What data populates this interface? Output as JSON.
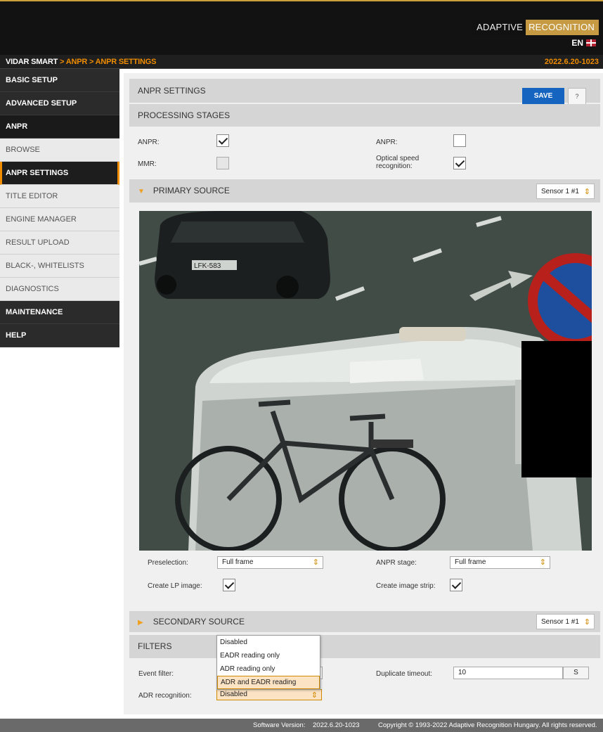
{
  "brand": {
    "word1": "ADAPTIVE",
    "word2": "RECOGNITION"
  },
  "language": "EN",
  "breadcrumb": {
    "root": "VIDAR SMART",
    "sep1": " > ",
    "section": "ANPR",
    "sep2": " > ",
    "page": "ANPR SETTINGS"
  },
  "version_top": "2022.6.20-1023",
  "sidebar": {
    "basic_setup": "BASIC SETUP",
    "advanced_setup": "ADVANCED SETUP",
    "anpr": "ANPR",
    "browse": "BROWSE",
    "anpr_settings": "ANPR SETTINGS",
    "title_editor": "TITLE EDITOR",
    "engine_manager": "ENGINE MANAGER",
    "result_upload": "RESULT UPLOAD",
    "black_whitelists": "BLACK-, WHITELISTS",
    "diagnostics": "DIAGNOSTICS",
    "maintenance": "MAINTENANCE",
    "help": "HELP"
  },
  "settings": {
    "title": "ANPR SETTINGS",
    "save_label": "SAVE",
    "help_label": "?"
  },
  "processing": {
    "title": "PROCESSING STAGES",
    "anpr_left_label": "ANPR:",
    "anpr_left_checked": true,
    "anpr_right_label": "ANPR:",
    "anpr_right_checked": false,
    "mmr_label": "MMR:",
    "mmr_checked": false,
    "osr_label_line1": "Optical speed",
    "osr_label_line2": "recognition:",
    "osr_checked": true
  },
  "primary": {
    "title": "PRIMARY SOURCE",
    "sensor": "Sensor 1 #1",
    "plate_text": "LFK-583",
    "preselection_label": "Preselection:",
    "preselection_value": "Full frame",
    "anpr_stage_label": "ANPR stage:",
    "anpr_stage_value": "Full frame",
    "create_lp_label": "Create LP image:",
    "create_lp_checked": true,
    "create_strip_label": "Create image strip:",
    "create_strip_checked": true
  },
  "secondary": {
    "title": "SECONDARY SOURCE",
    "sensor": "Sensor 1 #1"
  },
  "filters": {
    "title": "FILTERS",
    "event_filter_label": "Event filter:",
    "duplicate_label": "Duplicate timeout:",
    "duplicate_value": "10",
    "duplicate_unit": "S",
    "adr_label": "ADR recognition:",
    "adr_value": "Disabled",
    "adr_options": [
      "Disabled",
      "EADR reading only",
      "ADR reading only",
      "ADR and EADR reading"
    ]
  },
  "footer": {
    "version_label": "Software Version:",
    "version_value": "2022.6.20-1023",
    "copyright": "Copyright © 1993-2022 Adaptive Recognition Hungary. All rights reserved."
  },
  "colors": {
    "accent": "#f08c00",
    "save_button": "#1565c0",
    "brand_gold": "#c59a42",
    "header_black": "#121212"
  }
}
